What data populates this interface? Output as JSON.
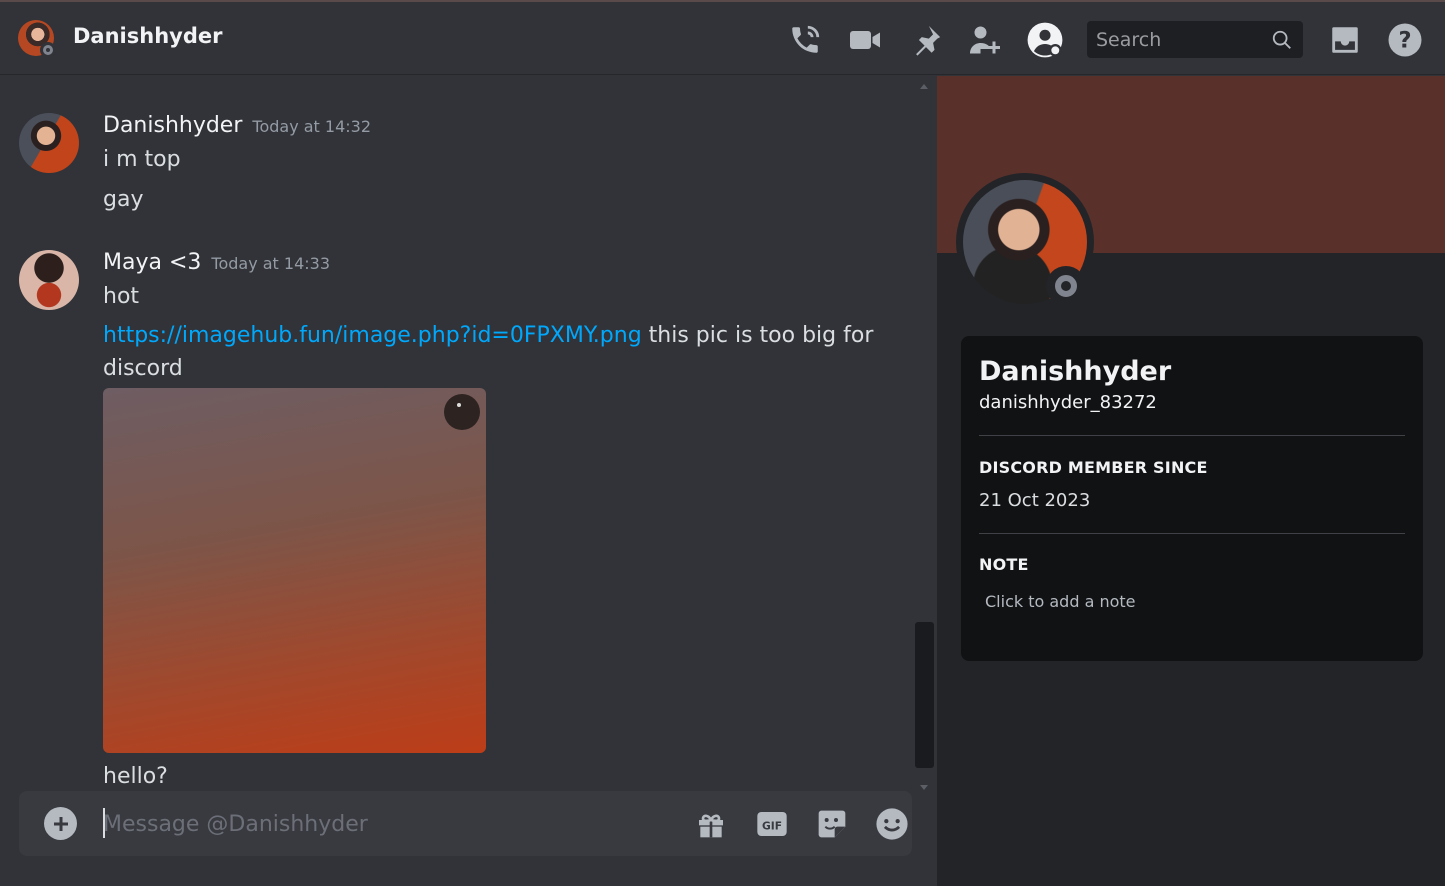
{
  "header": {
    "title": "Danishhyder",
    "search_placeholder": "Search"
  },
  "messages": [
    {
      "author": "Danishhyder",
      "timestamp": "Today at 14:32",
      "lines": [
        "i m top",
        "gay"
      ]
    },
    {
      "author": "Maya <3",
      "timestamp": "Today at 14:33",
      "lines": [
        "hot"
      ],
      "link": "https://imagehub.fun/image.php?id=0FPXMY.png",
      "link_suffix": " this pic is too big for",
      "wrap_line": "discord",
      "after_image": "hello?"
    }
  ],
  "composer": {
    "placeholder": "Message @Danishhyder"
  },
  "profile": {
    "display_name": "Danishhyder",
    "username": "danishhyder_83272",
    "member_since_title": "DISCORD MEMBER SINCE",
    "member_since": "21 Oct 2023",
    "note_title": "NOTE",
    "note_placeholder": "Click to add a note",
    "banner_color": "#5a302b"
  },
  "icons": [
    "phone-call-icon",
    "video-camera-icon",
    "pin-icon",
    "add-friend-icon",
    "user-profile-icon",
    "search-icon",
    "inbox-icon",
    "help-icon",
    "plus-icon",
    "gift-icon",
    "gif-icon",
    "sticker-icon",
    "emoji-icon"
  ]
}
